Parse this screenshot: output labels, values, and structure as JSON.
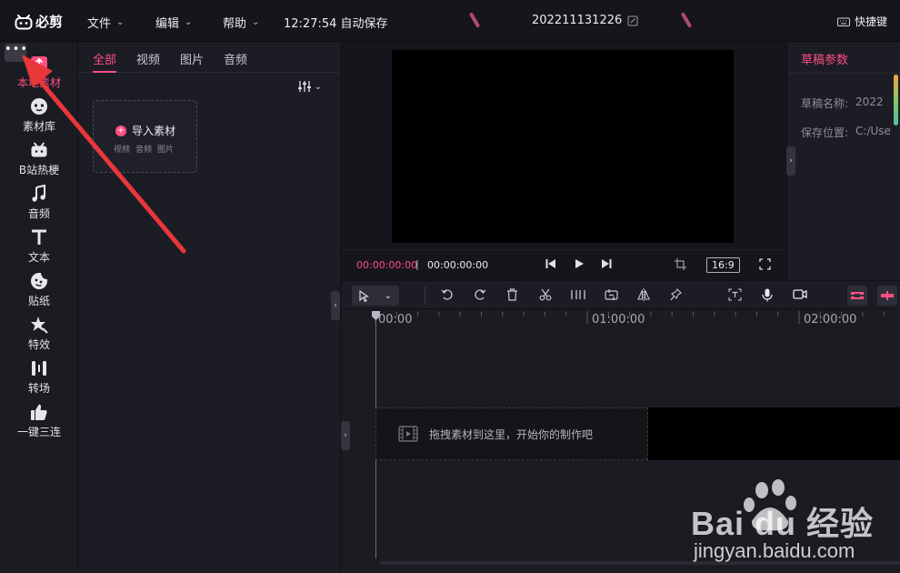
{
  "app": {
    "logo_text": "必剪",
    "menus": [
      {
        "label": "文件"
      },
      {
        "label": "编辑"
      },
      {
        "label": "帮助"
      }
    ],
    "autosave": "12:27:54 自动保存",
    "project_name": "202211131226",
    "shortcut_label": "快捷键"
  },
  "sidebar": {
    "more_label": "•••",
    "items": [
      {
        "label": "本地素材",
        "icon": "upload-icon",
        "active": true
      },
      {
        "label": "素材库",
        "icon": "library-icon"
      },
      {
        "label": "B站热梗",
        "icon": "bilibili-tv-icon"
      },
      {
        "label": "音频",
        "icon": "music-note-icon"
      },
      {
        "label": "文本",
        "icon": "text-t-icon"
      },
      {
        "label": "贴纸",
        "icon": "sticker-icon"
      },
      {
        "label": "特效",
        "icon": "effect-star-icon"
      },
      {
        "label": "转场",
        "icon": "transition-icon"
      },
      {
        "label": "一键三连",
        "icon": "thumbs-up-icon"
      }
    ]
  },
  "material": {
    "tabs": [
      {
        "label": "全部",
        "active": true
      },
      {
        "label": "视频"
      },
      {
        "label": "图片"
      },
      {
        "label": "音频"
      }
    ],
    "import": {
      "title": "导入素材",
      "types": [
        "视频",
        "音频",
        "图片"
      ]
    }
  },
  "preview": {
    "time_current": "00:00:00:00",
    "time_separator": "|",
    "time_total": "00:00:00:00",
    "aspect_ratio": "16:9"
  },
  "properties": {
    "tab_label": "草稿参数",
    "rows": [
      {
        "label": "草稿名称:",
        "value": "2022"
      },
      {
        "label": "保存位置:",
        "value": "C:/Use"
      }
    ]
  },
  "timeline": {
    "ruler_labels": [
      "00:00",
      "01:00:00",
      "02:00:00"
    ],
    "drop_hint": "拖拽素材到这里，开始你的制作吧"
  },
  "watermark": {
    "brand": "Bai du 经验",
    "url": "jingyan.baidu.com"
  },
  "colors": {
    "accent": "#fe4f83",
    "arrow": "#e8373a"
  }
}
